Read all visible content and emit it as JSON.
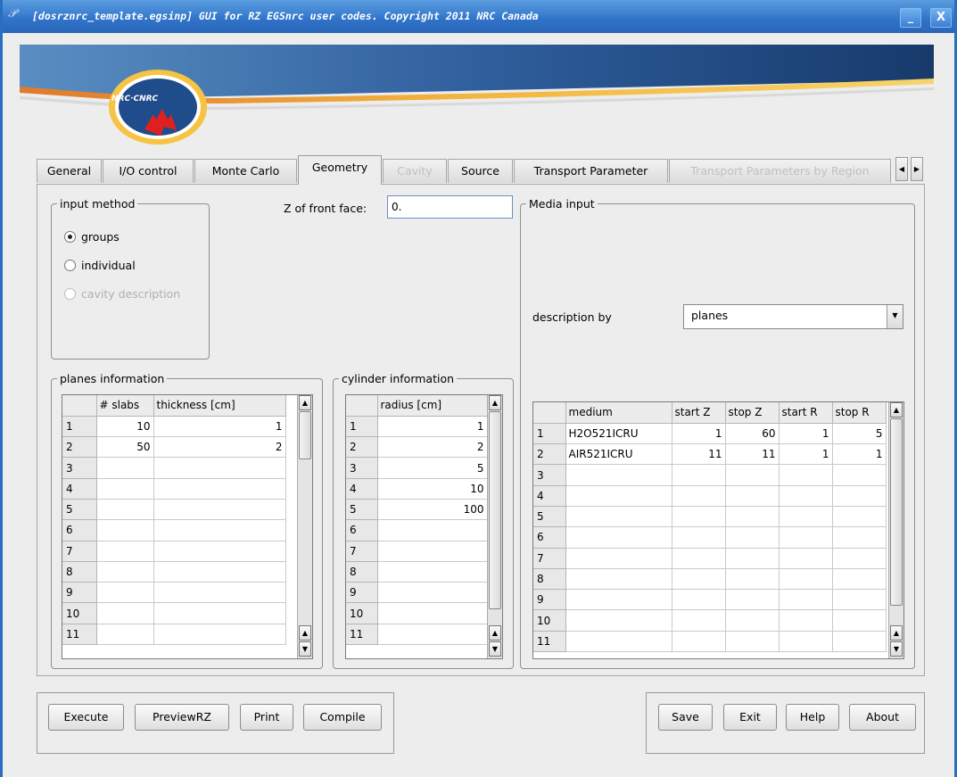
{
  "window": {
    "title": "[dosrznrc_template.egsinp] GUI for RZ EGSnrc user codes. Copyright 2011 NRC Canada",
    "minimize_label": "_",
    "close_label": "X"
  },
  "banner": {
    "logo_text": "NRC·CNRC"
  },
  "tabs": [
    {
      "label": "General",
      "state": "normal"
    },
    {
      "label": "I/O control",
      "state": "normal"
    },
    {
      "label": "Monte Carlo",
      "state": "normal"
    },
    {
      "label": "Geometry",
      "state": "active"
    },
    {
      "label": "Cavity",
      "state": "disabled"
    },
    {
      "label": "Source",
      "state": "normal"
    },
    {
      "label": "Transport Parameter",
      "state": "normal"
    },
    {
      "label": "Transport Parameters by Region",
      "state": "disabled"
    }
  ],
  "tab_scroll": {
    "left": "◀",
    "right": "▶"
  },
  "input_method": {
    "title": "input method",
    "options": [
      {
        "label": "groups",
        "selected": true,
        "enabled": true
      },
      {
        "label": "individual",
        "selected": false,
        "enabled": true
      },
      {
        "label": "cavity description",
        "selected": false,
        "enabled": false
      }
    ]
  },
  "front_face": {
    "label": "Z of front face:",
    "value": "0."
  },
  "media_input": {
    "title": "Media input",
    "description_label": "description by",
    "description_value": "planes",
    "columns": [
      "medium",
      "start Z",
      "stop Z",
      "start R",
      "stop R"
    ],
    "rows": [
      [
        "1",
        "H2O521ICRU",
        "1",
        "60",
        "1",
        "5"
      ],
      [
        "2",
        "AIR521ICRU",
        "11",
        "11",
        "1",
        "1"
      ],
      [
        "3",
        "",
        "",
        "",
        "",
        ""
      ],
      [
        "4",
        "",
        "",
        "",
        "",
        ""
      ],
      [
        "5",
        "",
        "",
        "",
        "",
        ""
      ],
      [
        "6",
        "",
        "",
        "",
        "",
        ""
      ],
      [
        "7",
        "",
        "",
        "",
        "",
        ""
      ],
      [
        "8",
        "",
        "",
        "",
        "",
        ""
      ],
      [
        "9",
        "",
        "",
        "",
        "",
        ""
      ],
      [
        "10",
        "",
        "",
        "",
        "",
        ""
      ],
      [
        "11",
        "",
        "",
        "",
        "",
        ""
      ]
    ]
  },
  "planes": {
    "title": "planes information",
    "columns": [
      "# slabs",
      "thickness [cm]"
    ],
    "rows": [
      [
        "1",
        "10",
        "1"
      ],
      [
        "2",
        "50",
        "2"
      ],
      [
        "3",
        "",
        ""
      ],
      [
        "4",
        "",
        ""
      ],
      [
        "5",
        "",
        ""
      ],
      [
        "6",
        "",
        ""
      ],
      [
        "7",
        "",
        ""
      ],
      [
        "8",
        "",
        ""
      ],
      [
        "9",
        "",
        ""
      ],
      [
        "10",
        "",
        ""
      ],
      [
        "11",
        "",
        ""
      ]
    ]
  },
  "cylinders": {
    "title": "cylinder information",
    "columns": [
      "radius [cm]"
    ],
    "rows": [
      [
        "1",
        "1"
      ],
      [
        "2",
        "2"
      ],
      [
        "3",
        "5"
      ],
      [
        "4",
        "10"
      ],
      [
        "5",
        "100"
      ],
      [
        "6",
        ""
      ],
      [
        "7",
        ""
      ],
      [
        "8",
        ""
      ],
      [
        "9",
        ""
      ],
      [
        "10",
        ""
      ],
      [
        "11",
        ""
      ]
    ]
  },
  "scroll": {
    "up": "▲",
    "down": "▼"
  },
  "actions_left": [
    "Execute",
    "PreviewRZ",
    "Print",
    "Compile"
  ],
  "actions_right": [
    "Save",
    "Exit",
    "Help",
    "About"
  ]
}
